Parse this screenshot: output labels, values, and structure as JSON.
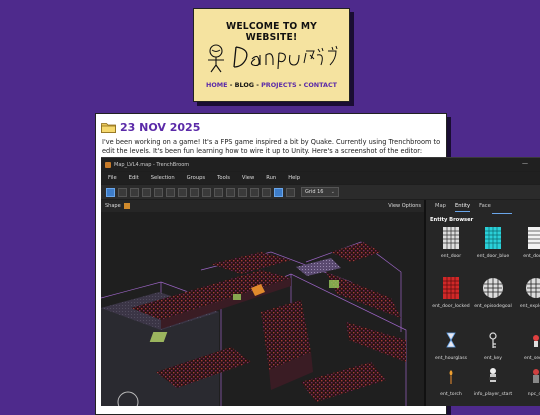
{
  "header": {
    "site_title": "WELCOME TO MY WEBSITE!",
    "signature_name": "Danpu タンプ",
    "nav": [
      {
        "label": "HOME",
        "current": false
      },
      {
        "label": "BLOG",
        "current": true
      },
      {
        "label": "PROJECTS",
        "current": false
      },
      {
        "label": "CONTACT",
        "current": false
      }
    ],
    "nav_separator": " - "
  },
  "post": {
    "date": "23 NOV 2025",
    "body": "I've been working on a game! It's a FPS game inspired a bit by Quake. Currently using Trenchbroom to edit the levels. It's been fun learning how to wire it up to Unity. Here's a screenshot of the editor:"
  },
  "editor": {
    "window_title": "Map_LVL4.map - TrenchBroom",
    "menu": [
      "File",
      "Edit",
      "Selection",
      "Groups",
      "Tools",
      "View",
      "Run",
      "Help"
    ],
    "grid_select": "Grid 16",
    "viewport_label": "Shape",
    "view_options": "View Options",
    "tabs": [
      {
        "label": "Map",
        "active": false
      },
      {
        "label": "Entity",
        "active": true
      },
      {
        "label": "Face",
        "active": false
      }
    ],
    "browser_title": "Entity Browser",
    "entities": [
      {
        "label": "ent_door",
        "icon": "door-icon"
      },
      {
        "label": "ent_door_blue",
        "icon": "blue-door-icon"
      },
      {
        "label": "ent_door_p",
        "icon": "door-icon"
      },
      {
        "label": "ent_door_locked",
        "icon": "red-door-icon"
      },
      {
        "label": "ent_episodegoal",
        "icon": "cage-icon"
      },
      {
        "label": "ent_exploding",
        "icon": "cage-icon"
      },
      {
        "label": "ent_hourglass",
        "icon": "hourglass-icon"
      },
      {
        "label": "ent_key",
        "icon": "key-icon"
      },
      {
        "label": "ent_secret",
        "icon": "secret-icon"
      },
      {
        "label": "ent_torch",
        "icon": "torch-icon"
      },
      {
        "label": "info_player_start",
        "icon": "player-icon"
      },
      {
        "label": "npc_de",
        "icon": "npc-icon"
      }
    ]
  },
  "colors": {
    "background": "#4e2a8c",
    "card": "#f5e3a0",
    "accent": "#5b2aa8",
    "editor_bg": "#1e1e1e",
    "selection": "#3e7dc9",
    "wireframe": "#b070e0"
  }
}
